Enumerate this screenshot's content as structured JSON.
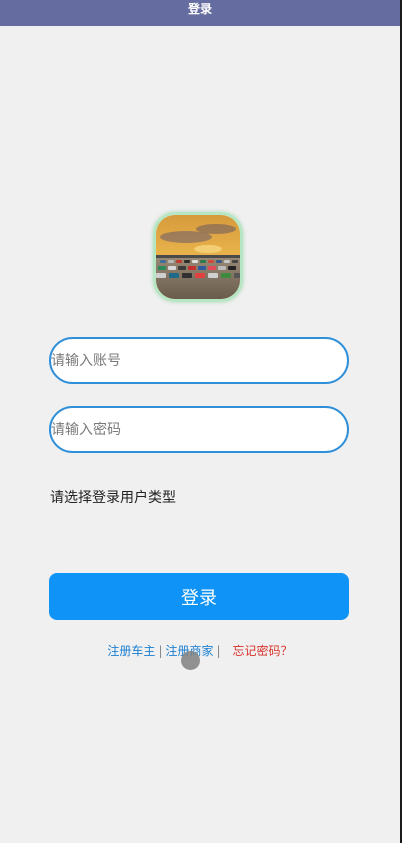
{
  "header": {
    "title": "登录"
  },
  "logo": {
    "icon": "parking-lot-cars-image"
  },
  "form": {
    "account_placeholder": "请输入账号",
    "password_placeholder": "请输入密码",
    "user_type_label": "请选择登录用户类型",
    "login_label": "登录"
  },
  "links": {
    "register_owner": "注册车主",
    "separator_1": "|",
    "register_merchant": "注册商家",
    "separator_2": "|",
    "forgot_password": "忘记密码？"
  },
  "colors": {
    "header_bg": "#656ca0",
    "input_border": "#2f8fd8",
    "button_bg": "#0f93f6",
    "link_blue": "#1a7fd0",
    "link_red": "#d8322a",
    "page_bg": "#f1f0f1"
  }
}
